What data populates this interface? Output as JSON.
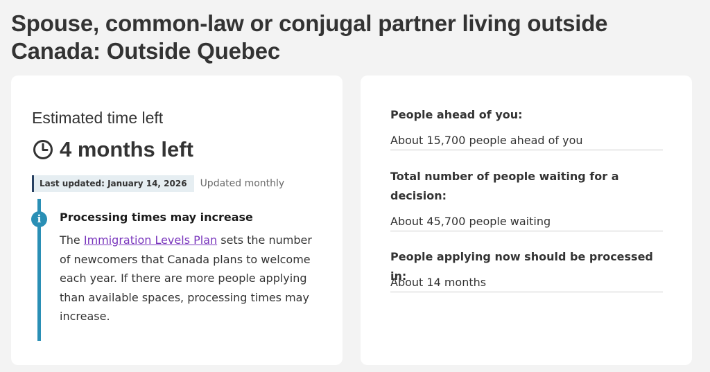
{
  "page": {
    "title": "Spouse, common-law or conjugal partner living outside Canada: Outside Quebec"
  },
  "estimate": {
    "heading": "Estimated time left",
    "icon": "clock-icon",
    "time_left": "4 months left",
    "last_updated": "Last updated: January 14, 2026",
    "frequency": "Updated monthly"
  },
  "notice": {
    "icon": "info-icon",
    "heading": "Processing times may increase",
    "body_before": "The ",
    "link_text": "Immigration Levels Plan",
    "body_after": " sets the number of newcomers that Canada plans to welcome each year. If there are more people applying than available spaces, processing times may increase."
  },
  "stats": [
    {
      "label": "People ahead of you:",
      "value": "About 15,700 people ahead of you"
    },
    {
      "label": "Total number of people waiting for a decision:",
      "value": "About 45,700 people waiting"
    },
    {
      "label": "People applying now should be processed in:",
      "value": "About 14 months"
    }
  ],
  "colors": {
    "background": "#f3f3f3",
    "card": "#ffffff",
    "accent_blue": "#2a8fb5",
    "link": "#7834bc",
    "badge_border": "#284162"
  }
}
